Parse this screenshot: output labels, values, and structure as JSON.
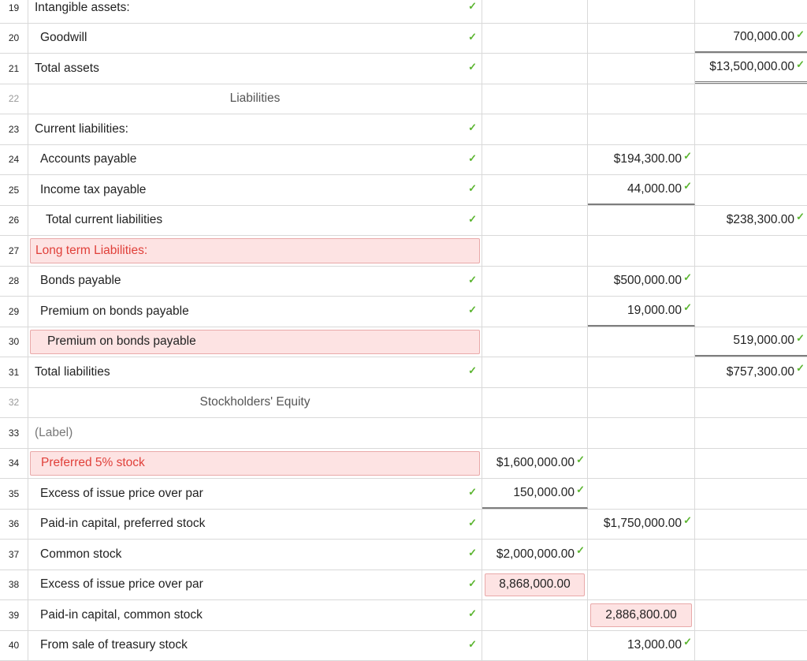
{
  "check_glyph": "✓",
  "colors": {
    "error_text": "#e0403a",
    "error_bg": "#fde3e3",
    "check": "#5cb531"
  },
  "rows": {
    "r19": {
      "num": "19",
      "desc": "Intangible assets:"
    },
    "r20": {
      "num": "20",
      "desc": "Goodwill",
      "c3": "700,000.00"
    },
    "r21": {
      "num": "21",
      "desc": "Total assets",
      "c3": "$13,500,000.00"
    },
    "r22": {
      "num": "22",
      "desc": "Liabilities"
    },
    "r23": {
      "num": "23",
      "desc": "Current liabilities:"
    },
    "r24": {
      "num": "24",
      "desc": "Accounts payable",
      "c2": "$194,300.00"
    },
    "r25": {
      "num": "25",
      "desc": "Income tax payable",
      "c2": "44,000.00"
    },
    "r26": {
      "num": "26",
      "desc": "Total current liabilities",
      "c3": "$238,300.00"
    },
    "r27": {
      "num": "27",
      "desc": "Long term Liabilities:"
    },
    "r28": {
      "num": "28",
      "desc": "Bonds payable",
      "c2": "$500,000.00"
    },
    "r29": {
      "num": "29",
      "desc": "Premium on bonds payable",
      "c2": "19,000.00"
    },
    "r30": {
      "num": "30",
      "desc": "Premium on bonds payable",
      "c3": "519,000.00"
    },
    "r31": {
      "num": "31",
      "desc": "Total liabilities",
      "c3": "$757,300.00"
    },
    "r32": {
      "num": "32",
      "desc": "Stockholders' Equity"
    },
    "r33": {
      "num": "33",
      "desc": "(Label)"
    },
    "r34": {
      "num": "34",
      "desc": "Preferred 5% stock",
      "c1": "$1,600,000.00"
    },
    "r35": {
      "num": "35",
      "desc": "Excess of issue price over par",
      "c1": "150,000.00"
    },
    "r36": {
      "num": "36",
      "desc": "Paid-in capital, preferred stock",
      "c2": "$1,750,000.00"
    },
    "r37": {
      "num": "37",
      "desc": "Common stock",
      "c1": "$2,000,000.00"
    },
    "r38": {
      "num": "38",
      "desc": "Excess of issue price over par",
      "c1": "8,868,000.00"
    },
    "r39": {
      "num": "39",
      "desc": "Paid-in capital, common stock",
      "c2": "2,886,800.00"
    },
    "r40": {
      "num": "40",
      "desc": "From sale of treasury stock",
      "c2": "13,000.00"
    }
  }
}
